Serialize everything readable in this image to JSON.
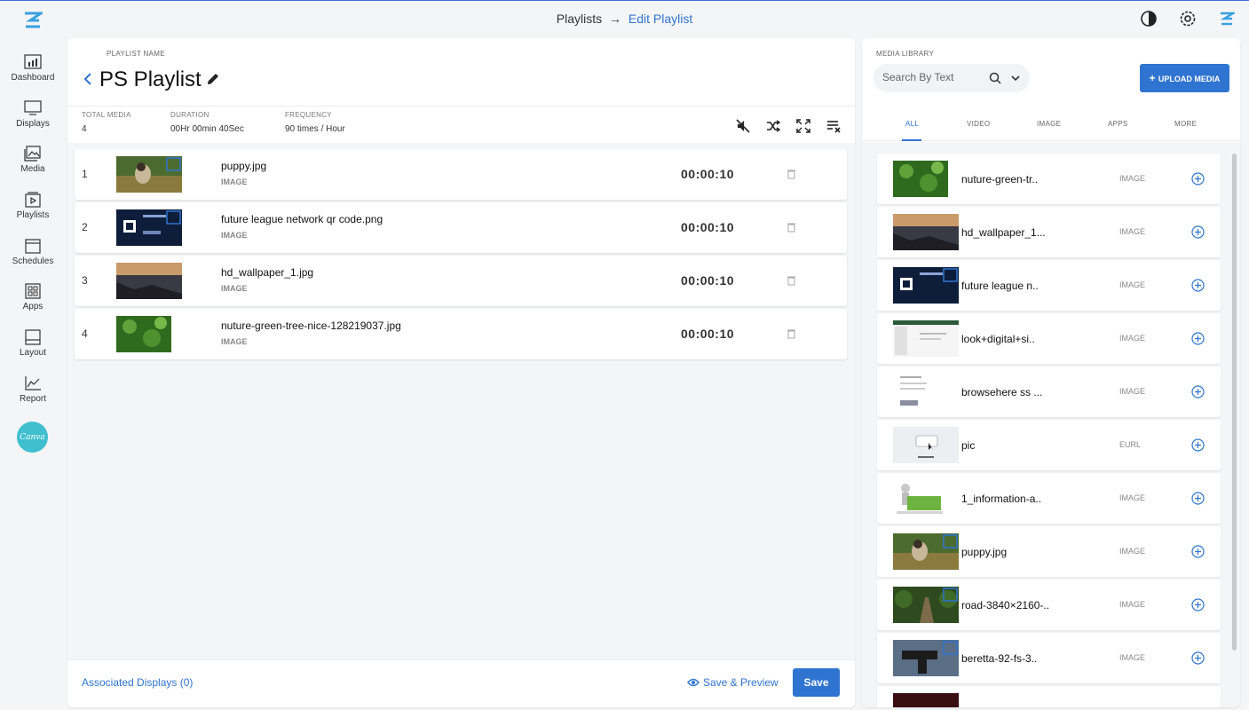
{
  "header": {
    "breadcrumb_root": "Playlists",
    "breadcrumb_current": "Edit Playlist"
  },
  "sidebar": {
    "items": [
      {
        "label": "Dashboard",
        "icon": "dashboard-icon"
      },
      {
        "label": "Displays",
        "icon": "monitor-icon"
      },
      {
        "label": "Media",
        "icon": "image-icon"
      },
      {
        "label": "Playlists",
        "icon": "playlist-icon"
      },
      {
        "label": "Schedules",
        "icon": "calendar-icon"
      },
      {
        "label": "Apps",
        "icon": "apps-icon"
      },
      {
        "label": "Layout",
        "icon": "layout-icon"
      },
      {
        "label": "Report",
        "icon": "chart-icon"
      }
    ],
    "canva_label": "Canva"
  },
  "playlist": {
    "caption": "PLAYLIST NAME",
    "name": "PS Playlist",
    "stats": {
      "total_media_label": "TOTAL MEDIA",
      "total_media": "4",
      "duration_label": "DURATION",
      "duration": "00Hr 00min 40Sec",
      "frequency_label": "FREQUENCY",
      "frequency": "90 times / Hour"
    },
    "items": [
      {
        "index": "1",
        "name": "puppy.jpg",
        "type": "IMAGE",
        "duration": "00:00:10"
      },
      {
        "index": "2",
        "name": "future league network qr code.png",
        "type": "IMAGE",
        "duration": "00:00:10"
      },
      {
        "index": "3",
        "name": "hd_wallpaper_1.jpg",
        "type": "IMAGE",
        "duration": "00:00:10"
      },
      {
        "index": "4",
        "name": "nuture-green-tree-nice-128219037.jpg",
        "type": "IMAGE",
        "duration": "00:00:10"
      }
    ],
    "footer": {
      "associated": "Associated Displays (0)",
      "save_preview": "Save & Preview",
      "save": "Save"
    }
  },
  "library": {
    "caption": "MEDIA LIBRARY",
    "search_placeholder": "Search By Text",
    "upload_label": "UPLOAD MEDIA",
    "tabs": [
      "ALL",
      "VIDEO",
      "IMAGE",
      "APPS",
      "MORE"
    ],
    "active_tab": "ALL",
    "items": [
      {
        "name": "nuture-green-tr..",
        "type": "IMAGE"
      },
      {
        "name": "hd_wallpaper_1...",
        "type": "IMAGE"
      },
      {
        "name": "future league n..",
        "type": "IMAGE"
      },
      {
        "name": "look+digital+si..",
        "type": "IMAGE"
      },
      {
        "name": "browsehere ss ...",
        "type": "IMAGE"
      },
      {
        "name": "pic",
        "type": "EURL"
      },
      {
        "name": "1_information-a..",
        "type": "IMAGE"
      },
      {
        "name": "puppy.jpg",
        "type": "IMAGE"
      },
      {
        "name": "road-3840×2160-..",
        "type": "IMAGE"
      },
      {
        "name": "beretta-92-fs-3..",
        "type": "IMAGE"
      }
    ]
  },
  "colors": {
    "accent": "#2f74d0",
    "page_bg": "#f4f5f7",
    "canva": "#3fbfcf"
  }
}
